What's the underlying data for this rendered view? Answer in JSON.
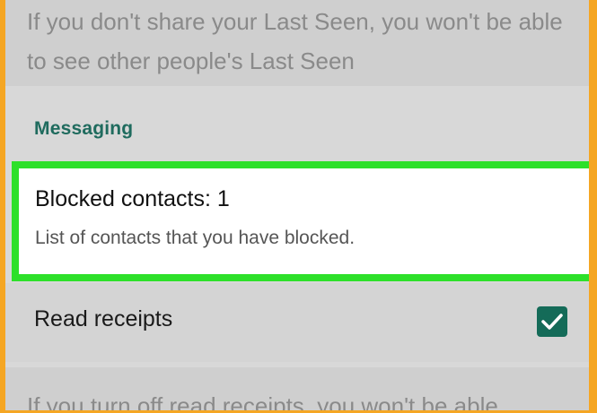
{
  "last_seen_info": {
    "text": "If you don't share your Last Seen, you won't be able to see other people's Last Seen"
  },
  "messaging": {
    "section_title": "Messaging",
    "blocked_contacts": {
      "title": "Blocked contacts: 1",
      "subtitle": "List of contacts that you have blocked."
    },
    "read_receipts": {
      "label": "Read receipts",
      "checked": true,
      "info": "If you turn off read receipts, you won't be able"
    }
  },
  "colors": {
    "highlight_border": "#2de02a",
    "accent": "#146b58",
    "frame": "#f5a623"
  }
}
